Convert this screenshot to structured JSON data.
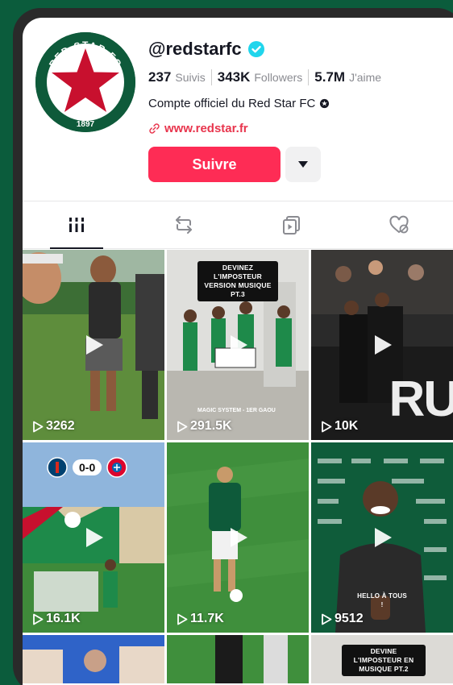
{
  "profile": {
    "handle": "@redstarfc",
    "following_count": "237",
    "following_label": "Suivis",
    "followers_count": "343K",
    "followers_label": "Followers",
    "likes_count": "5.7M",
    "likes_label": "J'aime",
    "bio": "Compte officiel du Red Star FC",
    "link": "www.redstar.fr",
    "follow_label": "Suivre",
    "avatar_text_top": "RED STAR FC",
    "avatar_text_bottom": "1897"
  },
  "tabs": [
    {
      "name": "videos",
      "icon": "grid-icon",
      "active": true
    },
    {
      "name": "reposts",
      "icon": "repost-icon",
      "active": false
    },
    {
      "name": "favorites",
      "icon": "bookmark-icon",
      "active": false
    },
    {
      "name": "liked",
      "icon": "liked-hidden-icon",
      "active": false
    }
  ],
  "videos": [
    {
      "views": "3262",
      "caption": ""
    },
    {
      "views": "291.5K",
      "caption": "DEVINEZ L'IMPOSTEUR VERSION MUSIQUE PT.3",
      "subcaption": "MAGIC SYSTEM - 1ER GAOU"
    },
    {
      "views": "10K",
      "caption": "",
      "overlay": "RU"
    },
    {
      "views": "16.1K",
      "caption": "",
      "score": "0-0"
    },
    {
      "views": "11.7K",
      "caption": ""
    },
    {
      "views": "9512",
      "caption": "HELLO À TOUS !"
    },
    {
      "views": "",
      "caption": ""
    },
    {
      "views": "",
      "caption": ""
    },
    {
      "views": "",
      "caption": "DEVINE L'IMPOSTEUR EN MUSIQUE PT.2"
    }
  ],
  "colors": {
    "background": "#0b5c3c",
    "accent": "#fe2c55",
    "verified": "#20d5ec",
    "link": "#e8354d",
    "club_green": "#0e5a3a",
    "club_red": "#c8102e"
  }
}
